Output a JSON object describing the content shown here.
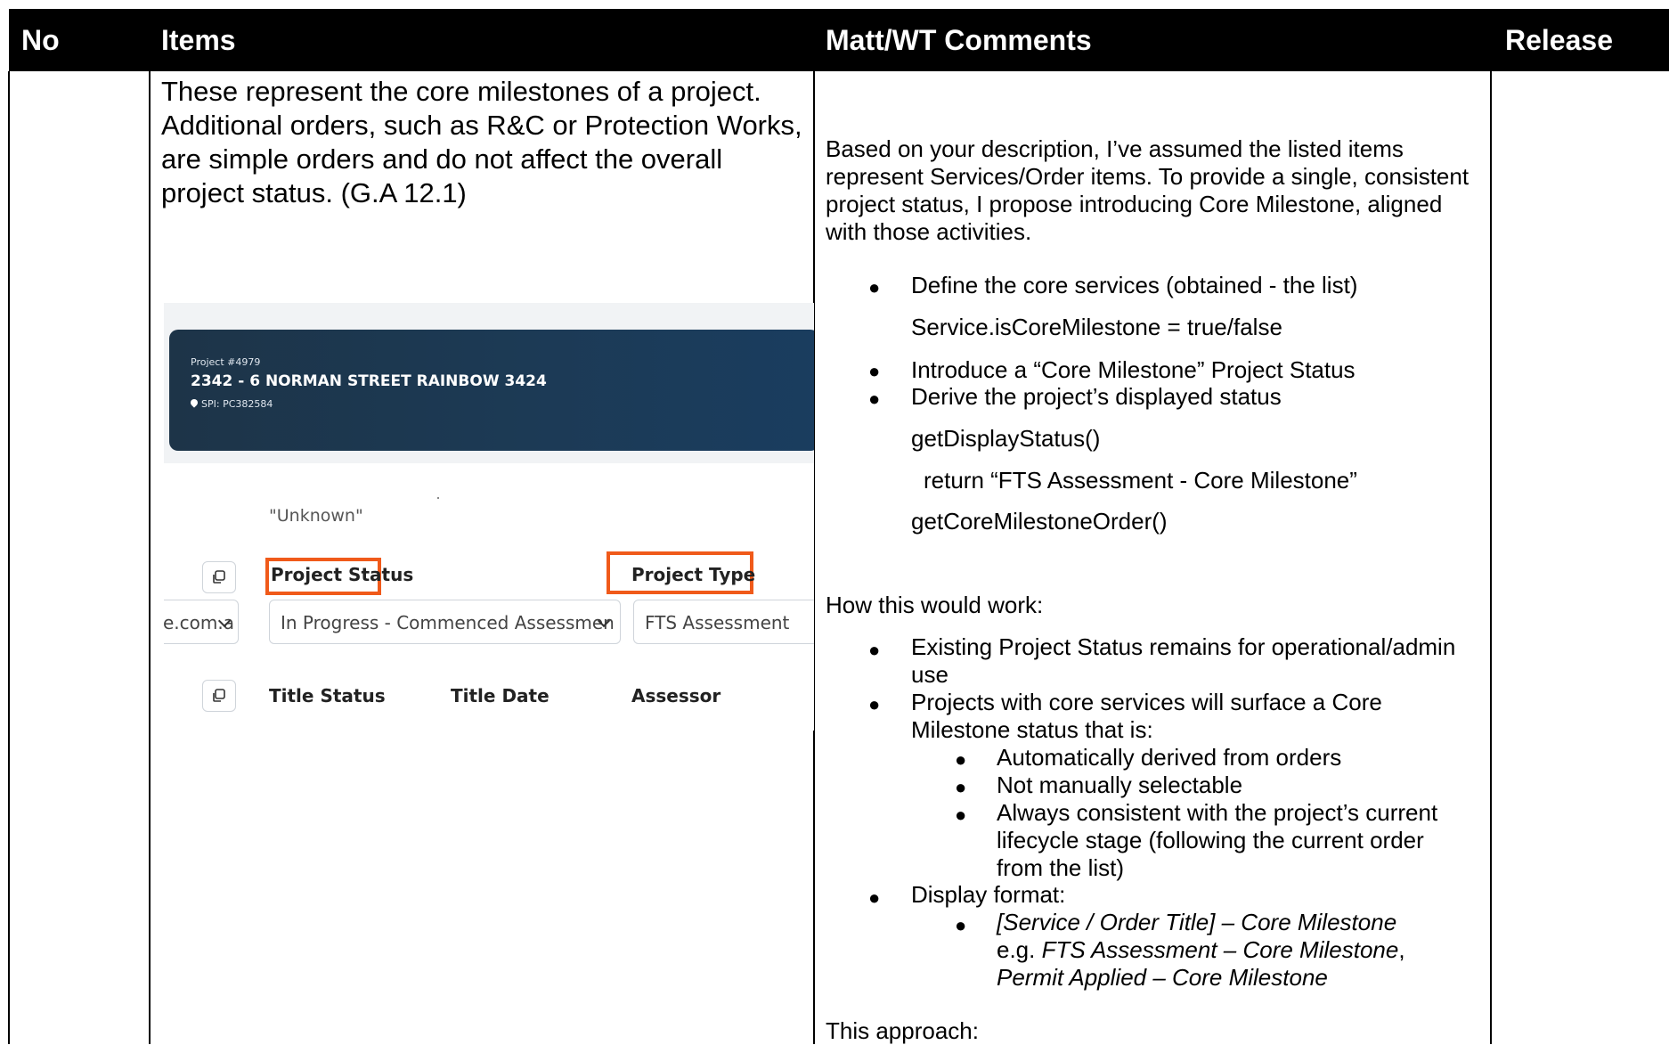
{
  "header": {
    "no": "No",
    "items": "Items",
    "comments": "Matt/WT Comments",
    "release": "Release"
  },
  "items_text": "These represent the core milestones of a project. Additional orders, such as R&C or Protection Works, are simple orders and do not affect the overall project status. (G.A 12.1)",
  "screenshot": {
    "project_no": "Project #4979",
    "address": "2342 - 6 NORMAN STREET RAINBOW 3424",
    "spi": "SPI: PC382584",
    "unknown": "\"Unknown\"",
    "project_status_label": "Project Status",
    "project_type_label": "Project Type",
    "email_fragment": "ne.com.a",
    "project_status_value": "In Progress - Commenced Assessmen",
    "project_type_value": "FTS Assessment",
    "title_status_label": "Title Status",
    "title_date_label": "Title Date",
    "assessor_label": "Assessor",
    "highlight_color": "#f05a1a",
    "banner_color": "#1c3a55"
  },
  "comments": {
    "intro": "Based on your description, I’ve assumed the listed items represent Services/Order items. To provide a single, consistent project status, I propose introducing Core Milestone, aligned with those activities.",
    "b1": "Define the core services (obtained - the list)",
    "code1": "Service.isCoreMilestone = true/false",
    "b2": "Introduce a “Core Milestone” Project Status",
    "b3": "Derive the project’s displayed status",
    "code2": "getDisplayStatus()",
    "code3": "return “FTS Assessment - Core Milestone”",
    "code4": "getCoreMilestoneOrder()",
    "how": "How this would work:",
    "w1": "Existing Project Status remains for operational/admin use",
    "w2": "Projects with core services will surface a Core Milestone status that is:",
    "s1": "Automatically derived from orders",
    "s2": "Not manually selectable",
    "s3": "Always consistent with the project’s current lifecycle stage (following the current order from the list)",
    "w3": "Display format:",
    "fmt": "[Service / Order Title] – Core Milestone",
    "eg_prefix": "e.g. ",
    "eg1": "FTS Assessment – Core Milestone",
    "eg_sep": ",",
    "eg2": "Permit Applied – Core Milestone",
    "approach": "This approach:"
  }
}
